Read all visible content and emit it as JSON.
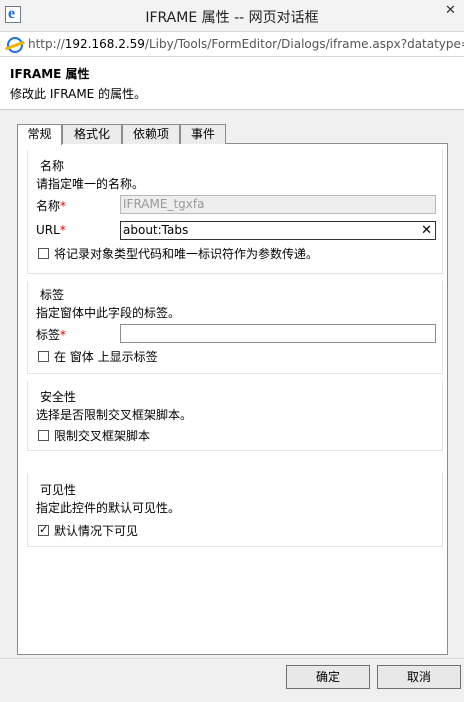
{
  "window": {
    "title": "IFRAME 属性 -- 网页对话框",
    "close": "✕"
  },
  "address": {
    "url_prefix": "http://",
    "url_host": "192.168.2.59",
    "url_path": "/Liby/Tools/FormEditor/Dialogs/iframe.aspx?datatype=if"
  },
  "header": {
    "title": "IFRAME 属性",
    "description": "修改此 IFRAME 的属性。"
  },
  "tabs": [
    {
      "label": "常规",
      "active": true
    },
    {
      "label": "格式化",
      "active": false
    },
    {
      "label": "依赖项",
      "active": false
    },
    {
      "label": "事件",
      "active": false
    }
  ],
  "name_section": {
    "title": "名称",
    "description": "请指定唯一的名称。",
    "name_label": "名称",
    "name_value": "IFRAME_tgxfa",
    "url_label": "URL",
    "url_value": "about:Tabs",
    "clear_icon": "✕",
    "pass_params_label": "将记录对象类型代码和唯一标识符作为参数传递。",
    "pass_params_checked": false,
    "required_mark": "*"
  },
  "label_section": {
    "title": "标签",
    "description": "指定窗体中此字段的标签。",
    "label_label": "标签",
    "label_value": "",
    "show_label": "在 窗体 上显示标签",
    "show_label_checked": false
  },
  "security_section": {
    "title": "安全性",
    "description": "选择是否限制交叉框架脚本。",
    "restrict_label": "限制交叉框架脚本",
    "restrict_checked": false
  },
  "visibility_section": {
    "title": "可见性",
    "description": "指定此控件的默认可见性。",
    "visible_label": "默认情况下可见",
    "visible_checked": true
  },
  "footer": {
    "ok": "确定",
    "cancel": "取消"
  }
}
